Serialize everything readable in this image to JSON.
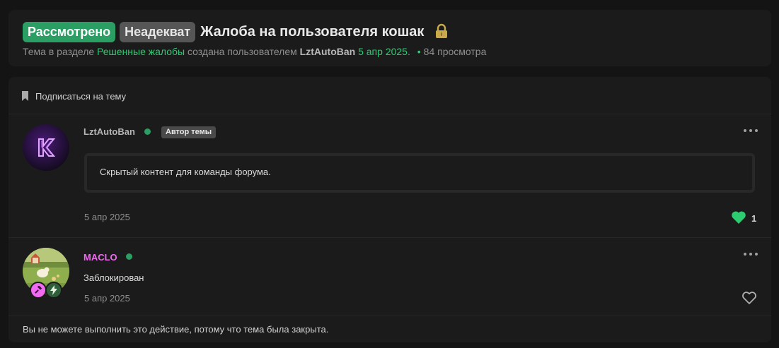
{
  "header": {
    "prefixes": [
      "Рассмотрено",
      "Неадекват"
    ],
    "title": "Жалоба на пользователя кошак",
    "meta": {
      "topic_in": "Тема в разделе",
      "section": "Решенные жалобы",
      "created_by": "создана пользователем",
      "author": "LztAutoBan",
      "date": "5 апр 2025",
      "views": "84 просмотра"
    }
  },
  "subscribe_label": "Подписаться на тему",
  "posts": [
    {
      "username": "LztAutoBan",
      "author_badge": "Автор темы",
      "content": "Скрытый контент для команды форума.",
      "date": "5 апр 2025",
      "likes": "1"
    },
    {
      "username": "MACLO",
      "content": "Заблокирован",
      "date": "5 апр 2025"
    }
  ],
  "closed_message": "Вы не можете выполнить это действие, потому что тема была закрыта.",
  "colors": {
    "accent_green": "#2ecc71",
    "prefix_green": "#2b9e63",
    "username_pink": "#f06bf0",
    "username_gray": "#b5b5b5"
  },
  "icons": [
    "lock-icon",
    "bookmark-icon",
    "more-icon",
    "heart-icon",
    "heart-outline-icon",
    "gavel-icon",
    "lightning-icon"
  ]
}
